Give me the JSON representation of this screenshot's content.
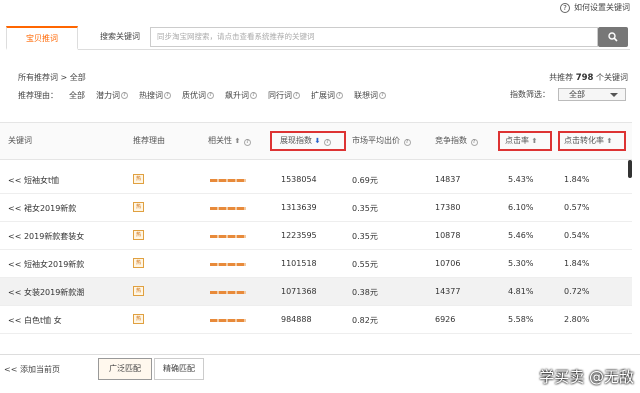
{
  "help": {
    "label": "如何设置关键词",
    "icon": "question-circle-icon"
  },
  "tabs": [
    {
      "label": "宝贝推词"
    },
    {
      "label": "搜索关键词"
    }
  ],
  "search": {
    "placeholder": "同步淘宝网搜索，请点击查看系统推荐的关键词",
    "button_icon": "search-icon"
  },
  "crumb": {
    "text": "所有推荐词 >   全部"
  },
  "total": {
    "prefix": "共推荐",
    "count": "798",
    "suffix": "个关键词"
  },
  "reasons": {
    "label": "推荐理由：",
    "items": [
      "全部",
      "潜力词",
      "热搜词",
      "质优词",
      "飙升词",
      "同行词",
      "扩展词",
      "联想词"
    ]
  },
  "filter": {
    "label": "指数筛选：",
    "value": "全部"
  },
  "table": {
    "headers": {
      "keyword": "关键词",
      "reason": "推荐理由",
      "relevance": "相关性",
      "impressions": "展现指数",
      "avg_bid": "市场平均出价",
      "competition": "竞争指数",
      "ctr": "点击率",
      "cvr": "点击转化率"
    },
    "rows": [
      {
        "prefix": "<<",
        "keyword": "短袖女t恤",
        "badge": "热",
        "impressions": "1538054",
        "bid": "0.69元",
        "competition": "14837",
        "ctr": "5.43%",
        "cvr": "1.84%"
      },
      {
        "prefix": "<<",
        "keyword": "裙女2019新款",
        "badge": "热",
        "impressions": "1313639",
        "bid": "0.35元",
        "competition": "17380",
        "ctr": "6.10%",
        "cvr": "0.57%"
      },
      {
        "prefix": "<<",
        "keyword": "2019新款套装女",
        "badge": "热",
        "impressions": "1223595",
        "bid": "0.35元",
        "competition": "10878",
        "ctr": "5.46%",
        "cvr": "0.54%"
      },
      {
        "prefix": "<<",
        "keyword": "短袖女2019新款",
        "badge": "热",
        "impressions": "1101518",
        "bid": "0.55元",
        "competition": "10706",
        "ctr": "5.30%",
        "cvr": "1.84%"
      },
      {
        "prefix": "<<",
        "keyword": "女装2019新款潮",
        "badge": "热",
        "impressions": "1071368",
        "bid": "0.38元",
        "competition": "14377",
        "ctr": "4.81%",
        "cvr": "0.72%"
      },
      {
        "prefix": "<<",
        "keyword": "白色t恤 女",
        "badge": "热",
        "impressions": "984888",
        "bid": "0.82元",
        "competition": "6926",
        "ctr": "5.58%",
        "cvr": "2.80%"
      }
    ]
  },
  "footer": {
    "add_label": "<< 添加当前页",
    "broad": "广泛匹配",
    "exact": "精确匹配"
  },
  "watermark": "学买卖 @无敌",
  "colors": {
    "accent": "#ff6600",
    "highlight_box": "#dd3333",
    "sort_active": "#2a62c8"
  }
}
